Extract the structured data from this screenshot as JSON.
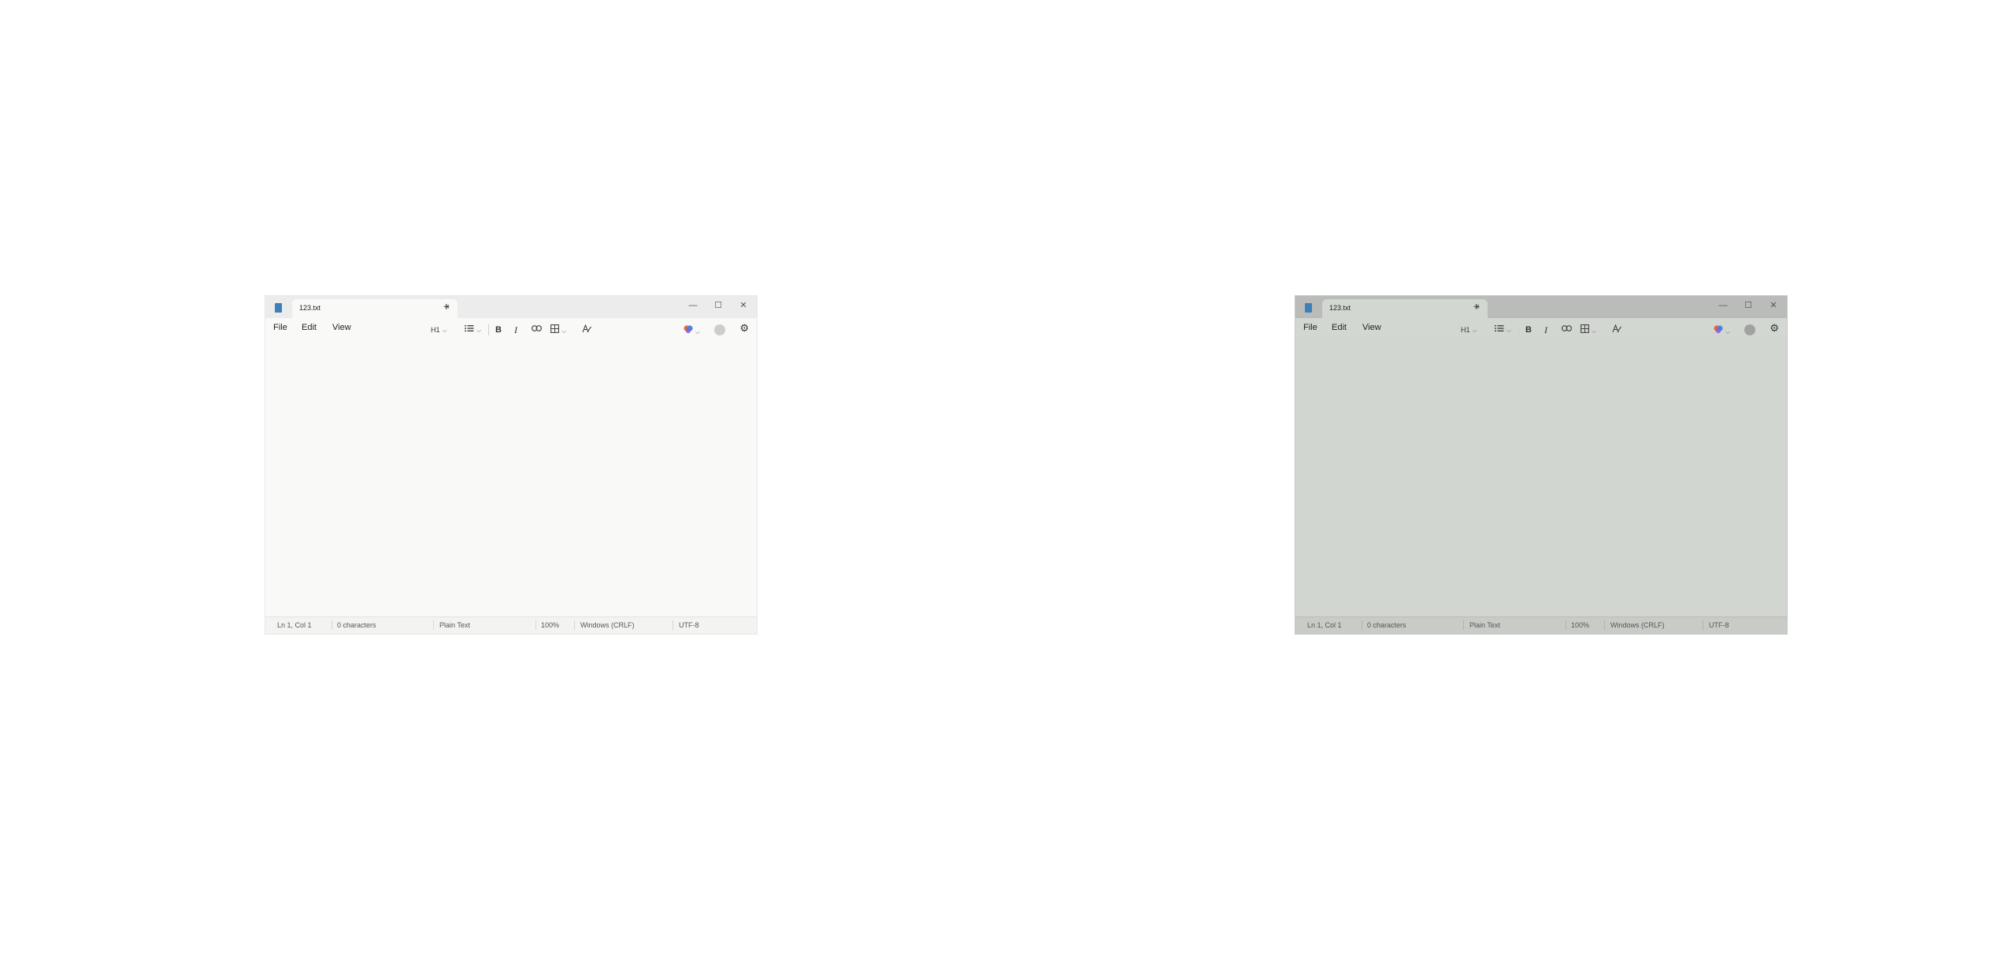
{
  "colors": {
    "background": "#ffffff",
    "window_light": "#f9f9f8",
    "window_gray": "#d3d7d2",
    "accent": "#3f7fb8"
  },
  "windows": [
    {
      "tab": {
        "title": "123.txt",
        "close_glyph": "×",
        "new_tab_glyph": "+"
      },
      "controls": {
        "minimize": "—",
        "maximize": "☐",
        "close": "✕"
      },
      "menu": [
        "File",
        "Edit",
        "View"
      ],
      "toolbar": {
        "heading": "H1",
        "bold": "B",
        "italic": "I"
      },
      "status": {
        "position": "Ln 1, Col 1",
        "characters": "0 characters",
        "type": "Plain Text",
        "zoom": "100%",
        "line_ending": "Windows (CRLF)",
        "encoding": "UTF-8"
      }
    },
    {
      "tab": {
        "title": "123.txt",
        "close_glyph": "×",
        "new_tab_glyph": "+"
      },
      "controls": {
        "minimize": "—",
        "maximize": "☐",
        "close": "✕"
      },
      "menu": [
        "File",
        "Edit",
        "View"
      ],
      "toolbar": {
        "heading": "H1",
        "bold": "B",
        "italic": "I"
      },
      "status": {
        "position": "Ln 1, Col 1",
        "characters": "0 characters",
        "type": "Plain Text",
        "zoom": "100%",
        "line_ending": "Windows (CRLF)",
        "encoding": "UTF-8"
      }
    }
  ]
}
